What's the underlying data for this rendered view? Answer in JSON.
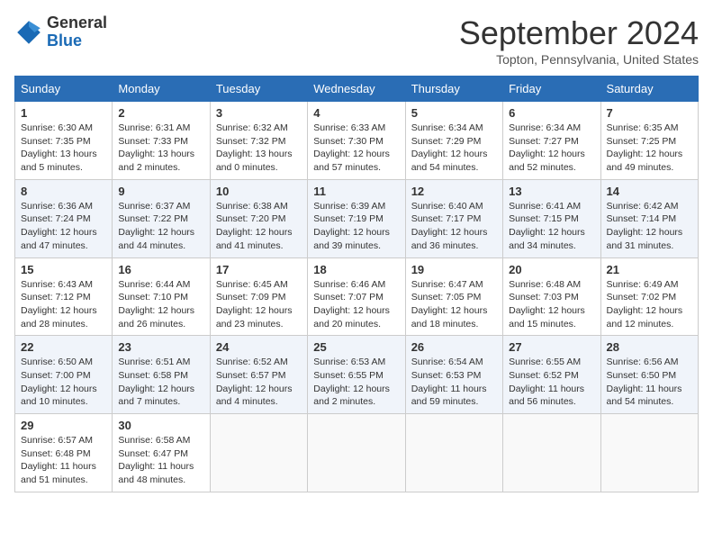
{
  "logo": {
    "line1": "General",
    "line2": "Blue"
  },
  "title": "September 2024",
  "location": "Topton, Pennsylvania, United States",
  "weekdays": [
    "Sunday",
    "Monday",
    "Tuesday",
    "Wednesday",
    "Thursday",
    "Friday",
    "Saturday"
  ],
  "weeks": [
    [
      {
        "day": "1",
        "detail": "Sunrise: 6:30 AM\nSunset: 7:35 PM\nDaylight: 13 hours\nand 5 minutes."
      },
      {
        "day": "2",
        "detail": "Sunrise: 6:31 AM\nSunset: 7:33 PM\nDaylight: 13 hours\nand 2 minutes."
      },
      {
        "day": "3",
        "detail": "Sunrise: 6:32 AM\nSunset: 7:32 PM\nDaylight: 13 hours\nand 0 minutes."
      },
      {
        "day": "4",
        "detail": "Sunrise: 6:33 AM\nSunset: 7:30 PM\nDaylight: 12 hours\nand 57 minutes."
      },
      {
        "day": "5",
        "detail": "Sunrise: 6:34 AM\nSunset: 7:29 PM\nDaylight: 12 hours\nand 54 minutes."
      },
      {
        "day": "6",
        "detail": "Sunrise: 6:34 AM\nSunset: 7:27 PM\nDaylight: 12 hours\nand 52 minutes."
      },
      {
        "day": "7",
        "detail": "Sunrise: 6:35 AM\nSunset: 7:25 PM\nDaylight: 12 hours\nand 49 minutes."
      }
    ],
    [
      {
        "day": "8",
        "detail": "Sunrise: 6:36 AM\nSunset: 7:24 PM\nDaylight: 12 hours\nand 47 minutes."
      },
      {
        "day": "9",
        "detail": "Sunrise: 6:37 AM\nSunset: 7:22 PM\nDaylight: 12 hours\nand 44 minutes."
      },
      {
        "day": "10",
        "detail": "Sunrise: 6:38 AM\nSunset: 7:20 PM\nDaylight: 12 hours\nand 41 minutes."
      },
      {
        "day": "11",
        "detail": "Sunrise: 6:39 AM\nSunset: 7:19 PM\nDaylight: 12 hours\nand 39 minutes."
      },
      {
        "day": "12",
        "detail": "Sunrise: 6:40 AM\nSunset: 7:17 PM\nDaylight: 12 hours\nand 36 minutes."
      },
      {
        "day": "13",
        "detail": "Sunrise: 6:41 AM\nSunset: 7:15 PM\nDaylight: 12 hours\nand 34 minutes."
      },
      {
        "day": "14",
        "detail": "Sunrise: 6:42 AM\nSunset: 7:14 PM\nDaylight: 12 hours\nand 31 minutes."
      }
    ],
    [
      {
        "day": "15",
        "detail": "Sunrise: 6:43 AM\nSunset: 7:12 PM\nDaylight: 12 hours\nand 28 minutes."
      },
      {
        "day": "16",
        "detail": "Sunrise: 6:44 AM\nSunset: 7:10 PM\nDaylight: 12 hours\nand 26 minutes."
      },
      {
        "day": "17",
        "detail": "Sunrise: 6:45 AM\nSunset: 7:09 PM\nDaylight: 12 hours\nand 23 minutes."
      },
      {
        "day": "18",
        "detail": "Sunrise: 6:46 AM\nSunset: 7:07 PM\nDaylight: 12 hours\nand 20 minutes."
      },
      {
        "day": "19",
        "detail": "Sunrise: 6:47 AM\nSunset: 7:05 PM\nDaylight: 12 hours\nand 18 minutes."
      },
      {
        "day": "20",
        "detail": "Sunrise: 6:48 AM\nSunset: 7:03 PM\nDaylight: 12 hours\nand 15 minutes."
      },
      {
        "day": "21",
        "detail": "Sunrise: 6:49 AM\nSunset: 7:02 PM\nDaylight: 12 hours\nand 12 minutes."
      }
    ],
    [
      {
        "day": "22",
        "detail": "Sunrise: 6:50 AM\nSunset: 7:00 PM\nDaylight: 12 hours\nand 10 minutes."
      },
      {
        "day": "23",
        "detail": "Sunrise: 6:51 AM\nSunset: 6:58 PM\nDaylight: 12 hours\nand 7 minutes."
      },
      {
        "day": "24",
        "detail": "Sunrise: 6:52 AM\nSunset: 6:57 PM\nDaylight: 12 hours\nand 4 minutes."
      },
      {
        "day": "25",
        "detail": "Sunrise: 6:53 AM\nSunset: 6:55 PM\nDaylight: 12 hours\nand 2 minutes."
      },
      {
        "day": "26",
        "detail": "Sunrise: 6:54 AM\nSunset: 6:53 PM\nDaylight: 11 hours\nand 59 minutes."
      },
      {
        "day": "27",
        "detail": "Sunrise: 6:55 AM\nSunset: 6:52 PM\nDaylight: 11 hours\nand 56 minutes."
      },
      {
        "day": "28",
        "detail": "Sunrise: 6:56 AM\nSunset: 6:50 PM\nDaylight: 11 hours\nand 54 minutes."
      }
    ],
    [
      {
        "day": "29",
        "detail": "Sunrise: 6:57 AM\nSunset: 6:48 PM\nDaylight: 11 hours\nand 51 minutes."
      },
      {
        "day": "30",
        "detail": "Sunrise: 6:58 AM\nSunset: 6:47 PM\nDaylight: 11 hours\nand 48 minutes."
      },
      {
        "day": "",
        "detail": ""
      },
      {
        "day": "",
        "detail": ""
      },
      {
        "day": "",
        "detail": ""
      },
      {
        "day": "",
        "detail": ""
      },
      {
        "day": "",
        "detail": ""
      }
    ]
  ]
}
